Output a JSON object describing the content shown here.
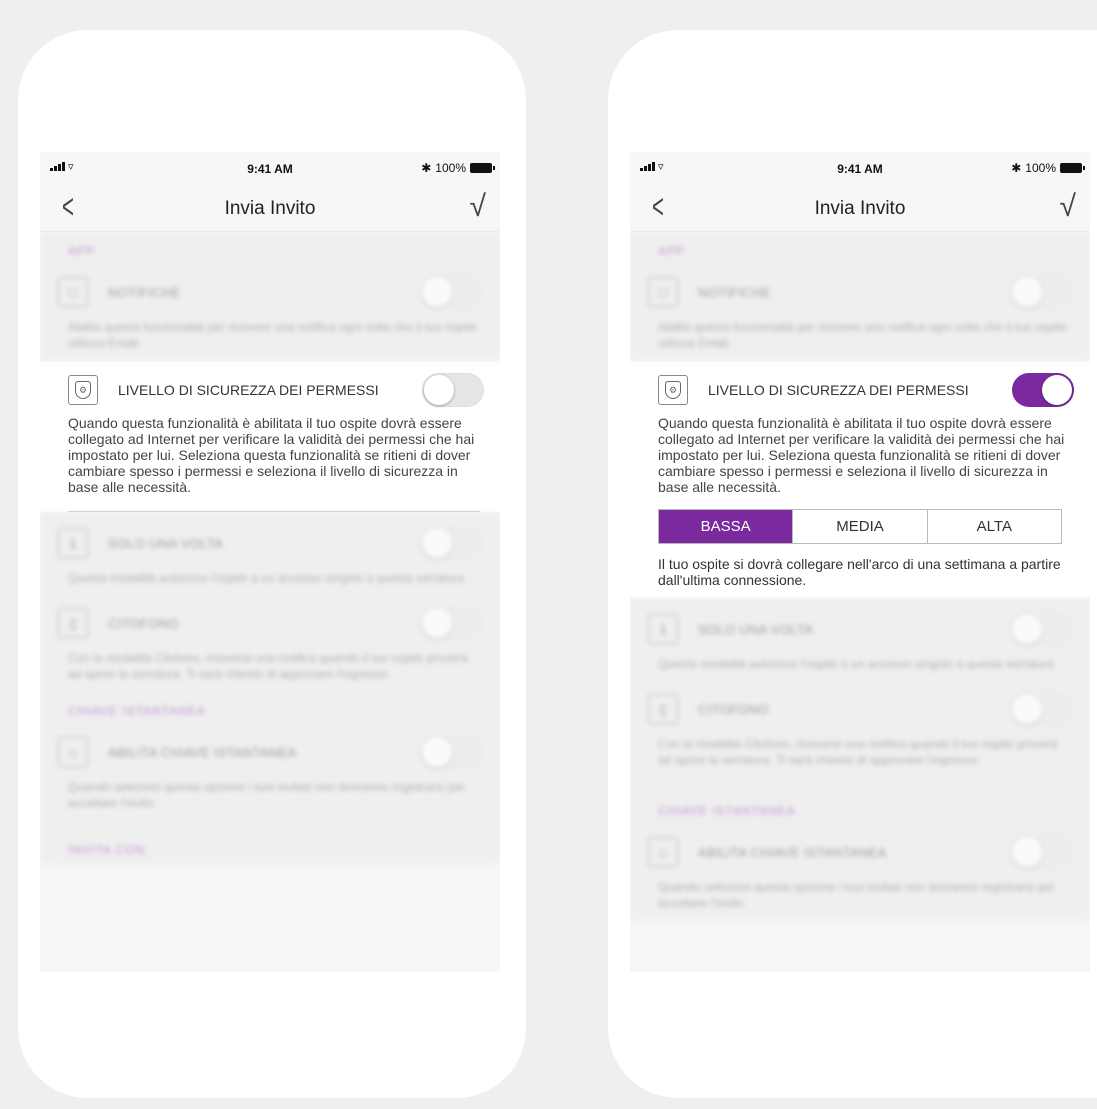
{
  "status_bar": {
    "time": "9:41 AM",
    "battery": "100%"
  },
  "nav": {
    "back_icon": "chevron-left-icon",
    "title": "Invia Invito",
    "done_icon": "checkmark-icon"
  },
  "sections": {
    "app": "APP",
    "instant_key": "CHIAVE ISTANTANEA",
    "invite_with": "INVITA CON"
  },
  "rows": {
    "notifications": {
      "label": "NOTIFICHE",
      "desc": "Abilita questa funzionalità per ricevere una notifica ogni volta che il tuo ospite utilizza Enlab"
    },
    "security": {
      "label": "LIVELLO DI SICUREZZA DEI PERMESSI",
      "desc": "Quando questa funzionalità è abilitata il tuo ospite dovrà essere collegato ad Internet per verificare la validità dei permessi che hai impostato per lui. Seleziona questa funzionalità se ritieni di dover cambiare spesso i permessi e seleziona il livello di sicurezza in base alle necessità.",
      "levels": [
        "BASSA",
        "MEDIA",
        "ALTA"
      ],
      "selected_level": "BASSA",
      "level_note": "Il tuo ospite si dovrà collegare nell'arco di una settimana a partire dall'ultima connessione."
    },
    "once": {
      "label": "SOLO UNA VOLTA",
      "desc": "Questa modalità autorizza l'ospite a un accesso singolo a questa serratura"
    },
    "intercom": {
      "label": "CITOFONO",
      "desc": "Con la modalità Citofono, riceverai una notifica quando il tuo ospite proverà ad aprire la serratura. Ti sarà chiesto di approvare l'ingresso."
    },
    "instant_key": {
      "label": "ABILITA CHIAVE ISTANTANEA",
      "desc": "Quando selezioni questa opzione i tuoi invitati non dovranno registrarsi per accettare l'invito"
    }
  },
  "toggles": {
    "left_security": false,
    "right_security": true
  },
  "colors": {
    "accent": "#7a2a9e"
  }
}
